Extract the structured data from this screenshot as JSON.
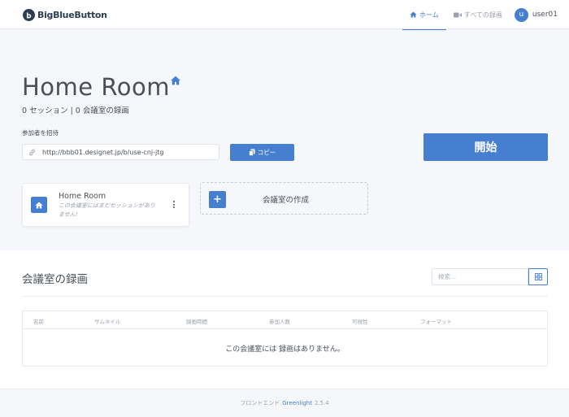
{
  "brand": {
    "name": "BigBlueButton"
  },
  "nav": {
    "home_label": "ホーム",
    "all_recordings_label": "すべての録画",
    "user_initial": "u",
    "user_name": "user01"
  },
  "room": {
    "title": "Home Room",
    "stats": "0 セッション | 0 会議室の録画",
    "invite_label": "参加者を招待",
    "invite_url": "http://bbb01.designet.jp/b/use-cnj-jtg",
    "copy_label": "コピー",
    "start_label": "開始"
  },
  "room_card": {
    "name": "Home Room",
    "description": "この会議室にはまだセッションがありません!"
  },
  "create_card": {
    "plus": "+",
    "label": "会議室の作成"
  },
  "recordings": {
    "title": "会議室の録画",
    "search_placeholder": "検索...",
    "columns": [
      "名前",
      "サムネイル",
      "録画時間",
      "参加人数",
      "可視性",
      "フォーマット"
    ],
    "empty_message": "この会議室には 録画はありません。"
  },
  "footer": {
    "prefix": "フロントエンド",
    "link": "Greenlight",
    "version": "2.5.4"
  },
  "colors": {
    "accent": "#467fcf",
    "text": "#495057",
    "muted": "#9aa0ac",
    "background": "#f5f7fb"
  },
  "icons": [
    "bbb-logo-icon",
    "home-icon",
    "video-icon",
    "link-icon",
    "copy-icon",
    "kebab-menu-icon",
    "grid-icon"
  ]
}
